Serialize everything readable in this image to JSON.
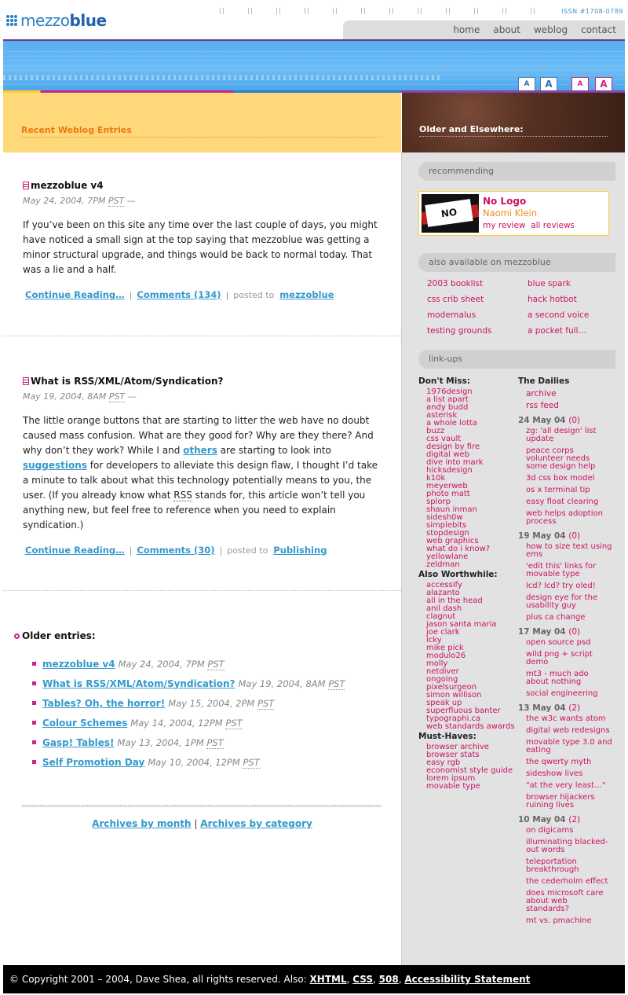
{
  "site": {
    "logo_light": "mezzo",
    "logo_bold": "blue",
    "issn": "ISSN #1708-0789"
  },
  "nav": [
    "home",
    "about",
    "weblog",
    "contact"
  ],
  "font_sizes": [
    "A",
    "A",
    "A",
    "A"
  ],
  "headers": {
    "left": "Recent Weblog Entries",
    "right": "Older and Elsewhere:"
  },
  "posts": [
    {
      "title": "mezzoblue v4",
      "date": "May 24, 2004, 7PM",
      "tz": "PST",
      "dash": "—",
      "body": "If you’ve been on this site any time over the last couple of days, you might have noticed a small sign at the top saying that mezzoblue was getting a minor structural upgrade, and things would be back to normal today. That was a lie and a half.",
      "continue": "Continue Reading…",
      "comments": "Comments (134)",
      "posted_to": "posted to",
      "category": "mezzoblue"
    },
    {
      "title": "What is RSS/XML/Atom/Syndication?",
      "date": "May 19, 2004, 8AM",
      "tz": "PST",
      "dash": "—",
      "body_1": "The little orange buttons that are starting to litter the web have no doubt caused mass confusion. What are they good for? Why are they there? And why don’t they work? While I and ",
      "link_others": "others",
      "body_2": " are starting to look into ",
      "link_suggestions": "suggestions",
      "body_3": " for developers to alleviate this design flaw, I thought I’d take a minute to talk about what this technology potentially means to you, the user. (If you already know what ",
      "abbr": "RSS",
      "body_4": " stands for, this article won’t tell you anything new, but feel free to reference when you need to explain syndication.)",
      "continue": "Continue Reading…",
      "comments": "Comments (30)",
      "posted_to": "posted to",
      "category": "Publishing"
    }
  ],
  "older": {
    "heading": "Older entries:",
    "items": [
      {
        "title": "mezzoblue v4",
        "date": "May 24, 2004, 7PM",
        "tz": "PST"
      },
      {
        "title": "What is RSS/XML/Atom/Syndication?",
        "date": "May 19, 2004, 8AM",
        "tz": "PST"
      },
      {
        "title": "Tables? Oh, the horror!",
        "date": "May 15, 2004, 2PM",
        "tz": "PST"
      },
      {
        "title": "Colour Schemes",
        "date": "May 14, 2004, 12PM",
        "tz": "PST"
      },
      {
        "title": "Gasp! Tables!",
        "date": "May 13, 2004, 1PM",
        "tz": "PST"
      },
      {
        "title": "Self Promotion Day",
        "date": "May 10, 2004, 12PM",
        "tz": "PST"
      }
    ]
  },
  "archives": {
    "by_month": "Archives by month",
    "sep": "|",
    "by_category": "Archives by category"
  },
  "sidebar": {
    "recommending": "recommending",
    "book": {
      "cover_text": "NO LOGO",
      "title": "No Logo",
      "author": "Naomi Klein",
      "my_review": "my review",
      "all_reviews": "all reviews"
    },
    "also_available": "also available on mezzoblue",
    "also_links": [
      "2003 booklist",
      "blue spark",
      "css crib sheet",
      "hack hotbot",
      "modernalus",
      "a second voice",
      "testing grounds",
      "a pocket full…"
    ],
    "link_ups": "link-ups",
    "dont_miss": {
      "heading": "Don't Miss:",
      "links": [
        "1976design",
        "a list apart",
        "andy budd",
        "asterisk",
        "a whole lotta",
        "buzz",
        "css vault",
        "design by fire",
        "digital web",
        "dive into mark",
        "hicksdesign",
        "k10k",
        "meyerweb",
        "photo matt",
        "splorp",
        "shaun inman",
        "sidesh0w",
        "simplebits",
        "stopdesign",
        "web graphics",
        "what do i know?",
        "yellowlane",
        "zeldman"
      ]
    },
    "also_worthwhile": {
      "heading": "Also Worthwhile:",
      "links": [
        "accessify",
        "alazanto",
        "all in the head",
        "anil dash",
        "clagnut",
        "jason santa maria",
        "joe clark",
        "lcky",
        "mike pick",
        "modulo26",
        "molly",
        "netdiver",
        "ongoing",
        "pixelsurgeon",
        "simon willison",
        "speak up",
        "superfluous banter",
        "typographi.ca",
        "web standards awards"
      ]
    },
    "must_haves": {
      "heading": "Must-Haves:",
      "links": [
        "browser archive",
        "browser stats",
        "easy rgb",
        "economist style guide",
        "lorem ipsum",
        "movable type"
      ]
    },
    "dailies": {
      "heading": "The Dailies",
      "links": [
        "archive",
        "rss feed"
      ],
      "days": [
        {
          "date": "24 May 04",
          "count": "(0)",
          "items": [
            "zg: 'all design' list update",
            "peace corps volunteer needs some design help",
            "3d css box model",
            "os x terminal tip",
            "easy float clearing",
            "web helps adoption process"
          ]
        },
        {
          "date": "19 May 04",
          "count": "(0)",
          "items": [
            "how to size text using ems",
            "'edit this' links for movable type",
            "lcd? lcd? try oled!",
            "design eye for the usability guy",
            "plus ca change"
          ]
        },
        {
          "date": "17 May 04",
          "count": "(0)",
          "items": [
            "open source psd",
            "wild png + script demo",
            "mt3 - much ado about nothing",
            "social engineering"
          ]
        },
        {
          "date": "13 May 04",
          "count": "(2)",
          "items": [
            "the w3c wants atom",
            "digital web redesigns",
            "movable type 3.0 and eating",
            "the qwerty myth",
            "sideshow lives",
            "\"at the very least…\"",
            "browser hijackers ruining lives"
          ]
        },
        {
          "date": "10 May 04",
          "count": "(2)",
          "items": [
            "on digicams",
            "illuminating blacked-out words",
            "teleportation breakthrough",
            "the cederholm effect",
            "does microsoft care about web standards?",
            "mt vs. pmachine"
          ]
        }
      ]
    }
  },
  "footer": {
    "copyright": "© Copyright 2001 – 2004, Dave Shea, all rights reserved. Also: ",
    "links": [
      "XHTML",
      "CSS",
      "508",
      "Accessibility Statement"
    ]
  },
  "colors": {
    "brand_blue": "#2d7fc1",
    "link_blue": "#3399cc",
    "accent_pink": "#cc1166",
    "header_orange": "#ee7711",
    "header_yellow": "#ffd87a"
  }
}
